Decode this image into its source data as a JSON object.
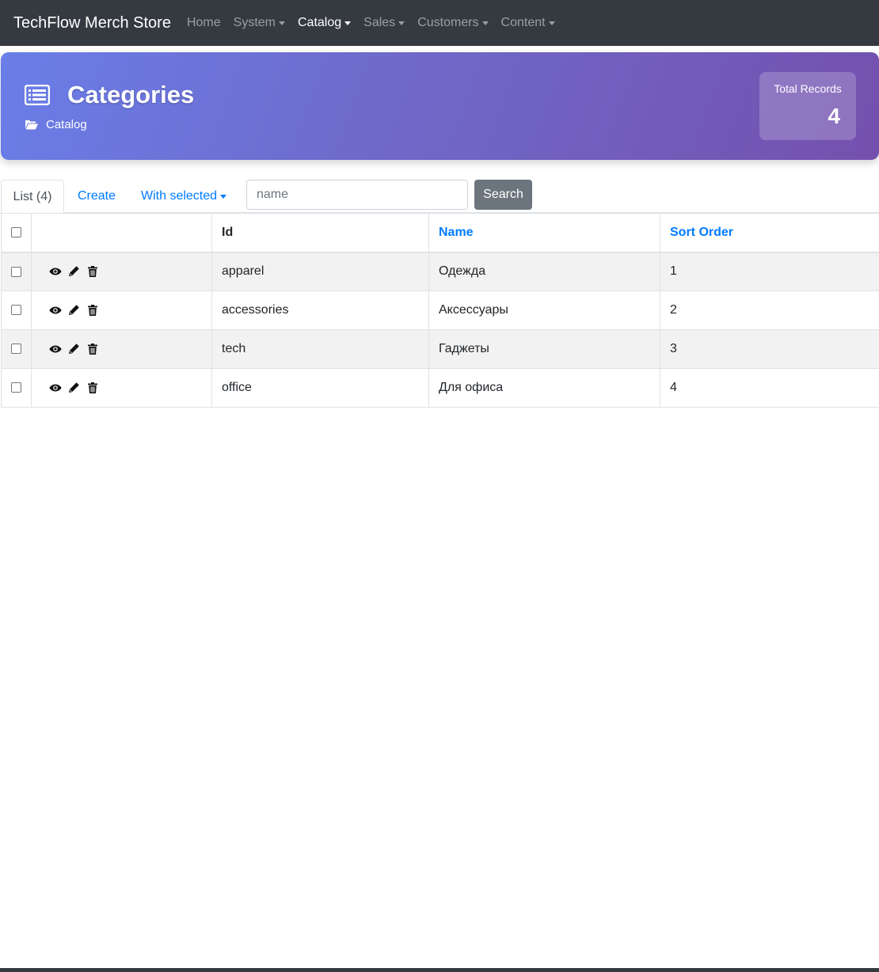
{
  "navbar": {
    "brand": "TechFlow Merch Store",
    "items": [
      {
        "label": "Home",
        "dropdown": false,
        "active": false
      },
      {
        "label": "System",
        "dropdown": true,
        "active": false
      },
      {
        "label": "Catalog",
        "dropdown": true,
        "active": true
      },
      {
        "label": "Sales",
        "dropdown": true,
        "active": false
      },
      {
        "label": "Customers",
        "dropdown": true,
        "active": false
      },
      {
        "label": "Content",
        "dropdown": true,
        "active": false
      }
    ]
  },
  "header": {
    "title": "Categories",
    "breadcrumb": "Catalog",
    "stats_label": "Total Records",
    "stats_value": "4",
    "gradient": [
      "#6a7ee8",
      "#7450ae"
    ]
  },
  "toolbar": {
    "tab_list": "List (4)",
    "tab_create": "Create",
    "tab_with_selected": "With selected",
    "search_placeholder": "name",
    "search_value": "",
    "search_button": "Search"
  },
  "table": {
    "columns": {
      "id": "Id",
      "name": "Name",
      "sort_order": "Sort Order"
    },
    "rows": [
      {
        "id": "apparel",
        "name": "Одежда",
        "sort_order": "1"
      },
      {
        "id": "accessories",
        "name": "Аксессуары",
        "sort_order": "2"
      },
      {
        "id": "tech",
        "name": "Гаджеты",
        "sort_order": "3"
      },
      {
        "id": "office",
        "name": "Для офиса",
        "sort_order": "4"
      }
    ],
    "row_actions": [
      "eye-icon",
      "pencil-icon",
      "trash-icon"
    ]
  },
  "colors": {
    "navbar_bg": "#343a40",
    "link": "#007bff",
    "button_secondary": "#6c757d",
    "stripe": "#f2f2f2"
  }
}
